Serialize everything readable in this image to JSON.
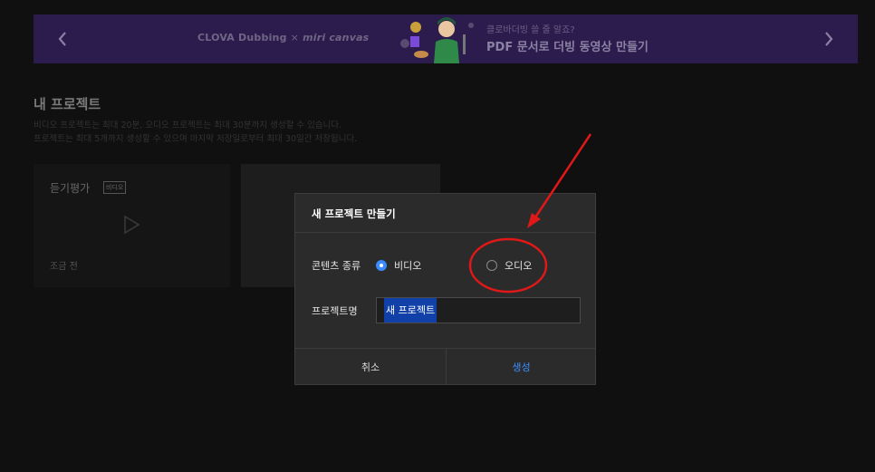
{
  "banner": {
    "brand_clova": "CLOVA Dubbing",
    "brand_x": "×",
    "brand_miri": "miri canvas",
    "promo_subtitle": "클로바더빙 쓸 줄 알죠?",
    "promo_title": "PDF 문서로 더빙 동영상 만들기",
    "prev_icon": "chevron-left",
    "next_icon": "chevron-right"
  },
  "section": {
    "title": "내 프로젝트",
    "desc_line1": "비디오 프로젝트는 최대 20분, 오디오 프로젝트는 최대 30분까지 생성할 수 있습니다.",
    "desc_line2": "프로젝트는 최대 5개까지 생성할 수 있으며 마지막 저장일로부터 최대 30일간 저장됩니다."
  },
  "projects": [
    {
      "title": "듣기평가",
      "badge": "비디오",
      "time": "조금 전"
    }
  ],
  "modal": {
    "title": "새 프로젝트 만들기",
    "content_type_label": "콘텐츠 종류",
    "options": [
      {
        "label": "비디오",
        "checked": true
      },
      {
        "label": "오디오",
        "checked": false
      }
    ],
    "name_label": "프로젝트명",
    "name_value": "새 프로젝트",
    "cancel_label": "취소",
    "create_label": "생성"
  },
  "colors": {
    "accent": "#3d8eff",
    "banner_bg": "#2c1b4d",
    "annotation": "#e01818"
  }
}
